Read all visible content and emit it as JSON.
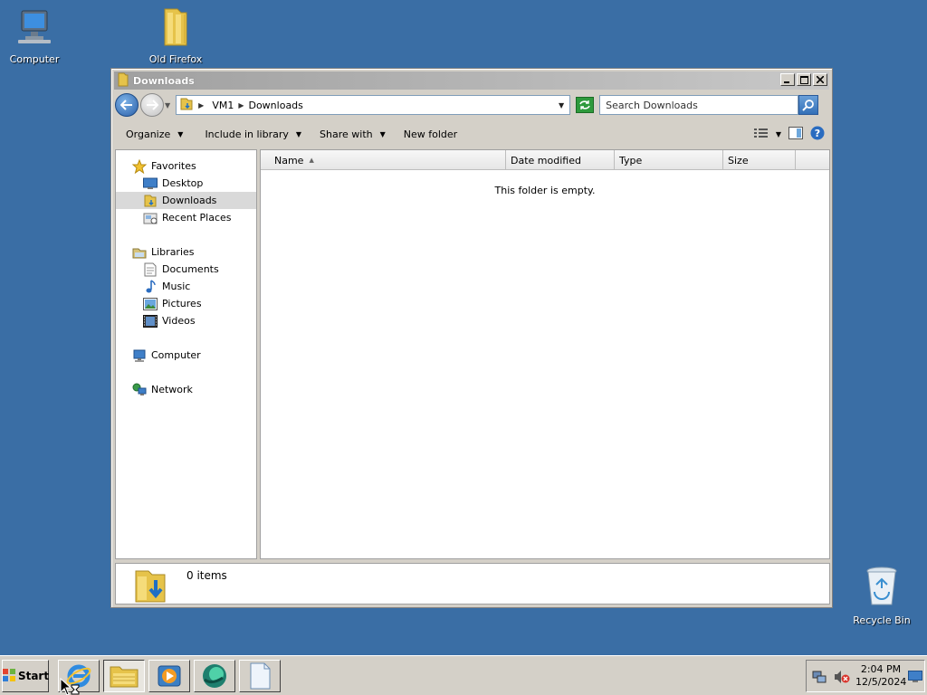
{
  "desktop": {
    "icons": [
      {
        "label": "Computer",
        "icon": "computer-icon"
      },
      {
        "label": "Old Firefox",
        "icon": "folder-icon"
      },
      {
        "label": "Recycle Bin",
        "icon": "recycle-bin-icon"
      }
    ]
  },
  "window": {
    "title": "Downloads",
    "address": {
      "crumbs": [
        "VM1",
        "Downloads"
      ]
    },
    "search_placeholder": "Search Downloads",
    "toolbar": {
      "organize": "Organize",
      "include_in_library": "Include in library",
      "share_with": "Share with",
      "new_folder": "New folder"
    },
    "nav": {
      "favorites": "Favorites",
      "desktop": "Desktop",
      "downloads": "Downloads",
      "recent_places": "Recent Places",
      "libraries": "Libraries",
      "documents": "Documents",
      "music": "Music",
      "pictures": "Pictures",
      "videos": "Videos",
      "computer": "Computer",
      "network": "Network"
    },
    "columns": {
      "name": "Name",
      "date_modified": "Date modified",
      "type": "Type",
      "size": "Size"
    },
    "empty_message": "This folder is empty.",
    "details": {
      "item_count": "0 items"
    }
  },
  "taskbar": {
    "start_label": "Start",
    "clock_time": "2:04 PM",
    "clock_date": "12/5/2024",
    "buttons": [
      "internet-explorer-icon",
      "windows-explorer-icon",
      "media-player-icon",
      "browser-icon",
      "notepad-icon"
    ]
  },
  "colors": {
    "desktop_bg": "#3a6ea5",
    "window_chrome": "#d4d0c8",
    "selection": "#d9d9d9"
  }
}
